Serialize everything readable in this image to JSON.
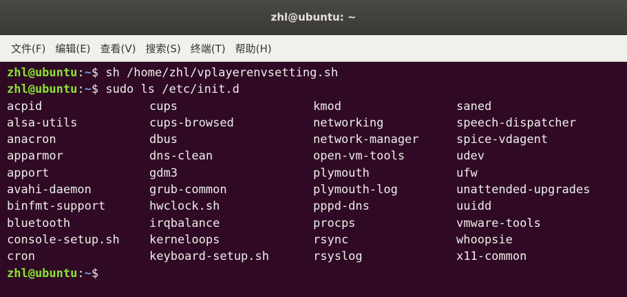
{
  "window": {
    "title": "zhl@ubuntu: ~"
  },
  "menu": [
    {
      "label": "文件(F)"
    },
    {
      "label": "编辑(E)"
    },
    {
      "label": "查看(V)"
    },
    {
      "label": "搜索(S)"
    },
    {
      "label": "终端(T)"
    },
    {
      "label": "帮助(H)"
    }
  ],
  "prompt": {
    "user": "zhl@ubuntu",
    "sep": ":",
    "path": "~",
    "symbol": "$"
  },
  "commands": [
    " sh /home/zhl/vplayerenvsetting.sh",
    " sudo ls /etc/init.d"
  ],
  "ls_output": [
    [
      "acpid",
      "cups",
      "kmod",
      "saned"
    ],
    [
      "alsa-utils",
      "cups-browsed",
      "networking",
      "speech-dispatcher"
    ],
    [
      "anacron",
      "dbus",
      "network-manager",
      "spice-vdagent"
    ],
    [
      "apparmor",
      "dns-clean",
      "open-vm-tools",
      "udev"
    ],
    [
      "apport",
      "gdm3",
      "plymouth",
      "ufw"
    ],
    [
      "avahi-daemon",
      "grub-common",
      "plymouth-log",
      "unattended-upgrades"
    ],
    [
      "binfmt-support",
      "hwclock.sh",
      "pppd-dns",
      "uuidd"
    ],
    [
      "bluetooth",
      "irqbalance",
      "procps",
      "vmware-tools"
    ],
    [
      "console-setup.sh",
      "kerneloops",
      "rsync",
      "whoopsie"
    ],
    [
      "cron",
      "keyboard-setup.sh",
      "rsyslog",
      "x11-common"
    ]
  ],
  "colors": {
    "background": "#300a24",
    "prompt_user": "#8ae234",
    "prompt_path": "#729fcf",
    "text": "#eeeeec"
  }
}
